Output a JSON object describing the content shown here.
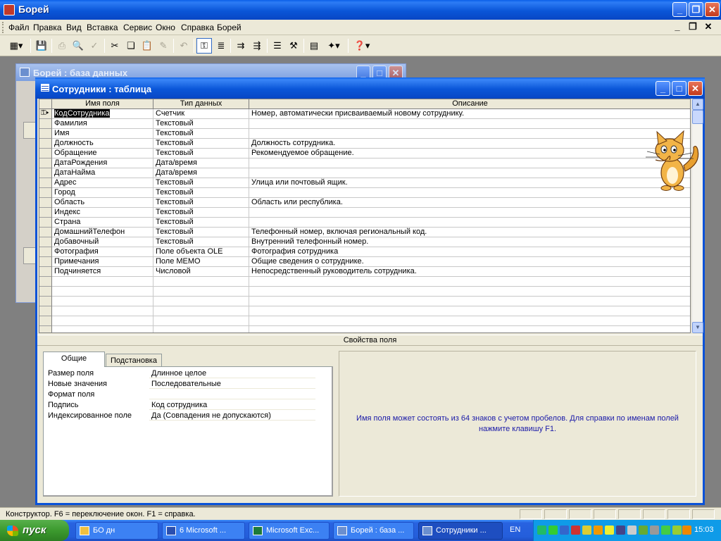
{
  "app": {
    "title": "Борей"
  },
  "menu": [
    "Файл",
    "Правка",
    "Вид",
    "Вставка",
    "Сервис",
    "Окно",
    "Справка",
    "Борей"
  ],
  "toolbar": {
    "buttons": [
      "view-icon",
      "save-icon",
      "print-icon",
      "preview-icon",
      "spell-icon",
      "cut-icon",
      "copy-icon",
      "paste-icon",
      "format-painter-icon",
      "undo-icon",
      "primary-key-icon",
      "indexes-icon",
      "insert-rows-icon",
      "delete-rows-icon",
      "properties-icon",
      "build-icon",
      "database-window-icon",
      "new-object-icon",
      "help-icon"
    ]
  },
  "db_window": {
    "title": "Борей : база данных"
  },
  "table_window": {
    "title": "Сотрудники : таблица",
    "columns": [
      "Имя поля",
      "Тип данных",
      "Описание"
    ],
    "rows": [
      {
        "name": "КодСотрудника",
        "type": "Счетчик",
        "desc": "Номер, автоматически присваиваемый новому сотруднику."
      },
      {
        "name": "Фамилия",
        "type": "Текстовый",
        "desc": ""
      },
      {
        "name": "Имя",
        "type": "Текстовый",
        "desc": ""
      },
      {
        "name": "Должность",
        "type": "Текстовый",
        "desc": "Должность сотрудника."
      },
      {
        "name": "Обращение",
        "type": "Текстовый",
        "desc": "Рекомендуемое обращение."
      },
      {
        "name": "ДатаРождения",
        "type": "Дата/время",
        "desc": ""
      },
      {
        "name": "ДатаНайма",
        "type": "Дата/время",
        "desc": ""
      },
      {
        "name": "Адрес",
        "type": "Текстовый",
        "desc": "Улица или почтовый ящик."
      },
      {
        "name": "Город",
        "type": "Текстовый",
        "desc": ""
      },
      {
        "name": "Область",
        "type": "Текстовый",
        "desc": "Область или республика."
      },
      {
        "name": "Индекс",
        "type": "Текстовый",
        "desc": ""
      },
      {
        "name": "Страна",
        "type": "Текстовый",
        "desc": ""
      },
      {
        "name": "ДомашнийТелефон",
        "type": "Текстовый",
        "desc": "Телефонный номер, включая региональный код."
      },
      {
        "name": "Добавочный",
        "type": "Текстовый",
        "desc": "Внутренний телефонный номер."
      },
      {
        "name": "Фотография",
        "type": "Поле объекта OLE",
        "desc": "Фотография сотрудника"
      },
      {
        "name": "Примечания",
        "type": "Поле MEMO",
        "desc": "Общие сведения о сотруднике."
      },
      {
        "name": "Подчиняется",
        "type": "Числовой",
        "desc": "Непосредственный руководитель сотрудника."
      }
    ],
    "empty_rows": 6,
    "properties_header": "Свойства поля",
    "tabs": [
      "Общие",
      "Подстановка"
    ],
    "properties": [
      {
        "label": "Размер поля",
        "value": "Длинное целое"
      },
      {
        "label": "Новые значения",
        "value": "Последовательные"
      },
      {
        "label": "Формат поля",
        "value": ""
      },
      {
        "label": "Подпись",
        "value": "Код сотрудника"
      },
      {
        "label": "Индексированное поле",
        "value": "Да (Совпадения не допускаются)"
      }
    ],
    "help_text": "Имя поля может состоять из 64 знаков с учетом пробелов.  Для справки по именам полей нажмите клавишу F1."
  },
  "status": {
    "text": "Конструктор.  F6 = переключение окон.  F1 = справка."
  },
  "taskbar": {
    "start": "пуск",
    "tasks": [
      "БО дн",
      "6 Microsoft ...",
      "Microsoft Exc...",
      "Борей : база ...",
      "Сотрудники ..."
    ],
    "lang": "EN",
    "clock": "15:03"
  },
  "colors": {
    "title_blue": "#0a56d8",
    "help_text": "#1a1aa8",
    "start_green": "#3c9a2e"
  }
}
